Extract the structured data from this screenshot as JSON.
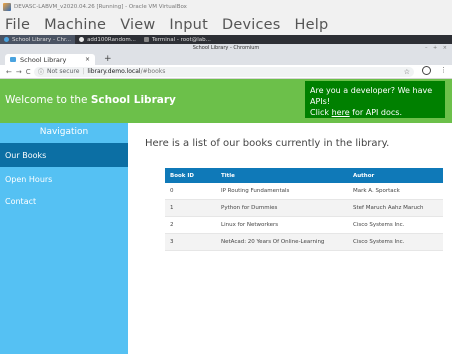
{
  "vbox": {
    "title": "DEVASC-LABVM_v2020.04.26 [Running] - Oracle VM VirtualBox",
    "menu": [
      "File",
      "Machine",
      "View",
      "Input",
      "Devices",
      "Help"
    ]
  },
  "taskbar": {
    "items": [
      "School Library - Chr...",
      "add100Random...",
      "Terminal - root@lab..."
    ]
  },
  "browser": {
    "window_title": "School Library - Chromium",
    "tab_title": "School Library",
    "tab_close": "×",
    "new_tab": "+",
    "security_label": "Not secure",
    "url_host": "library.demo.local",
    "url_path": "/#books"
  },
  "header": {
    "welcome_prefix": "Welcome to the ",
    "welcome_bold": "School Library",
    "api_line1": "Are you a developer? We have APIs!",
    "api_click": "Click ",
    "api_here": "here",
    "api_suffix": " for API docs."
  },
  "sidebar": {
    "title": "Navigation",
    "items": [
      "Our Books",
      "Open Hours",
      "Contact"
    ]
  },
  "main": {
    "intro": "Here is a list of our books currently in the library.",
    "columns": [
      "Book ID",
      "Title",
      "Author"
    ],
    "rows": [
      [
        "0",
        "IP Routing Fundamentals",
        "Mark A. Sportack"
      ],
      [
        "1",
        "Python for Dummies",
        "Stef Maruch Aahz Maruch"
      ],
      [
        "2",
        "Linux for Networkers",
        "Cisco Systems Inc."
      ],
      [
        "3",
        "NetAcad: 20 Years Of Online-Learning",
        "Cisco Systems Inc."
      ]
    ]
  }
}
